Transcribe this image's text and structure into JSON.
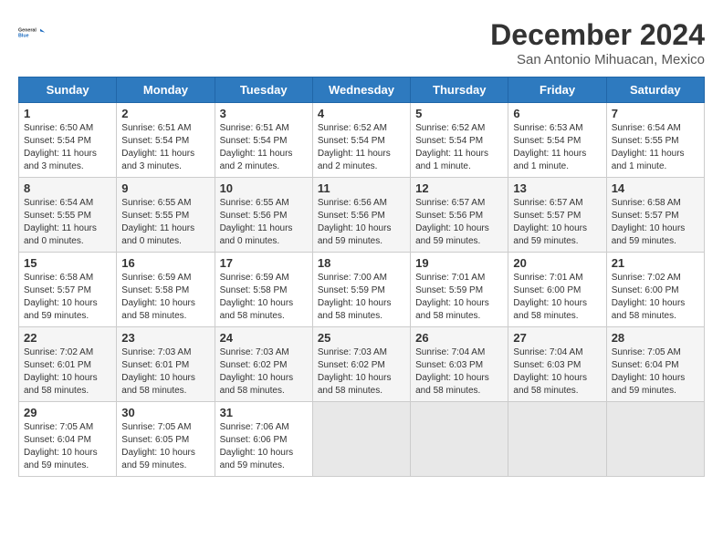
{
  "logo": {
    "line1": "General",
    "line2": "Blue"
  },
  "title": "December 2024",
  "subtitle": "San Antonio Mihuacan, Mexico",
  "weekdays": [
    "Sunday",
    "Monday",
    "Tuesday",
    "Wednesday",
    "Thursday",
    "Friday",
    "Saturday"
  ],
  "weeks": [
    [
      {
        "day": "1",
        "sunrise": "6:50 AM",
        "sunset": "5:54 PM",
        "daylight": "11 hours and 3 minutes."
      },
      {
        "day": "2",
        "sunrise": "6:51 AM",
        "sunset": "5:54 PM",
        "daylight": "11 hours and 3 minutes."
      },
      {
        "day": "3",
        "sunrise": "6:51 AM",
        "sunset": "5:54 PM",
        "daylight": "11 hours and 2 minutes."
      },
      {
        "day": "4",
        "sunrise": "6:52 AM",
        "sunset": "5:54 PM",
        "daylight": "11 hours and 2 minutes."
      },
      {
        "day": "5",
        "sunrise": "6:52 AM",
        "sunset": "5:54 PM",
        "daylight": "11 hours and 1 minute."
      },
      {
        "day": "6",
        "sunrise": "6:53 AM",
        "sunset": "5:54 PM",
        "daylight": "11 hours and 1 minute."
      },
      {
        "day": "7",
        "sunrise": "6:54 AM",
        "sunset": "5:55 PM",
        "daylight": "11 hours and 1 minute."
      }
    ],
    [
      {
        "day": "8",
        "sunrise": "6:54 AM",
        "sunset": "5:55 PM",
        "daylight": "11 hours and 0 minutes."
      },
      {
        "day": "9",
        "sunrise": "6:55 AM",
        "sunset": "5:55 PM",
        "daylight": "11 hours and 0 minutes."
      },
      {
        "day": "10",
        "sunrise": "6:55 AM",
        "sunset": "5:56 PM",
        "daylight": "11 hours and 0 minutes."
      },
      {
        "day": "11",
        "sunrise": "6:56 AM",
        "sunset": "5:56 PM",
        "daylight": "10 hours and 59 minutes."
      },
      {
        "day": "12",
        "sunrise": "6:57 AM",
        "sunset": "5:56 PM",
        "daylight": "10 hours and 59 minutes."
      },
      {
        "day": "13",
        "sunrise": "6:57 AM",
        "sunset": "5:57 PM",
        "daylight": "10 hours and 59 minutes."
      },
      {
        "day": "14",
        "sunrise": "6:58 AM",
        "sunset": "5:57 PM",
        "daylight": "10 hours and 59 minutes."
      }
    ],
    [
      {
        "day": "15",
        "sunrise": "6:58 AM",
        "sunset": "5:57 PM",
        "daylight": "10 hours and 59 minutes."
      },
      {
        "day": "16",
        "sunrise": "6:59 AM",
        "sunset": "5:58 PM",
        "daylight": "10 hours and 58 minutes."
      },
      {
        "day": "17",
        "sunrise": "6:59 AM",
        "sunset": "5:58 PM",
        "daylight": "10 hours and 58 minutes."
      },
      {
        "day": "18",
        "sunrise": "7:00 AM",
        "sunset": "5:59 PM",
        "daylight": "10 hours and 58 minutes."
      },
      {
        "day": "19",
        "sunrise": "7:01 AM",
        "sunset": "5:59 PM",
        "daylight": "10 hours and 58 minutes."
      },
      {
        "day": "20",
        "sunrise": "7:01 AM",
        "sunset": "6:00 PM",
        "daylight": "10 hours and 58 minutes."
      },
      {
        "day": "21",
        "sunrise": "7:02 AM",
        "sunset": "6:00 PM",
        "daylight": "10 hours and 58 minutes."
      }
    ],
    [
      {
        "day": "22",
        "sunrise": "7:02 AM",
        "sunset": "6:01 PM",
        "daylight": "10 hours and 58 minutes."
      },
      {
        "day": "23",
        "sunrise": "7:03 AM",
        "sunset": "6:01 PM",
        "daylight": "10 hours and 58 minutes."
      },
      {
        "day": "24",
        "sunrise": "7:03 AM",
        "sunset": "6:02 PM",
        "daylight": "10 hours and 58 minutes."
      },
      {
        "day": "25",
        "sunrise": "7:03 AM",
        "sunset": "6:02 PM",
        "daylight": "10 hours and 58 minutes."
      },
      {
        "day": "26",
        "sunrise": "7:04 AM",
        "sunset": "6:03 PM",
        "daylight": "10 hours and 58 minutes."
      },
      {
        "day": "27",
        "sunrise": "7:04 AM",
        "sunset": "6:03 PM",
        "daylight": "10 hours and 58 minutes."
      },
      {
        "day": "28",
        "sunrise": "7:05 AM",
        "sunset": "6:04 PM",
        "daylight": "10 hours and 59 minutes."
      }
    ],
    [
      {
        "day": "29",
        "sunrise": "7:05 AM",
        "sunset": "6:04 PM",
        "daylight": "10 hours and 59 minutes."
      },
      {
        "day": "30",
        "sunrise": "7:05 AM",
        "sunset": "6:05 PM",
        "daylight": "10 hours and 59 minutes."
      },
      {
        "day": "31",
        "sunrise": "7:06 AM",
        "sunset": "6:06 PM",
        "daylight": "10 hours and 59 minutes."
      },
      null,
      null,
      null,
      null
    ]
  ],
  "labels": {
    "sunrise": "Sunrise:",
    "sunset": "Sunset:",
    "daylight": "Daylight:"
  }
}
